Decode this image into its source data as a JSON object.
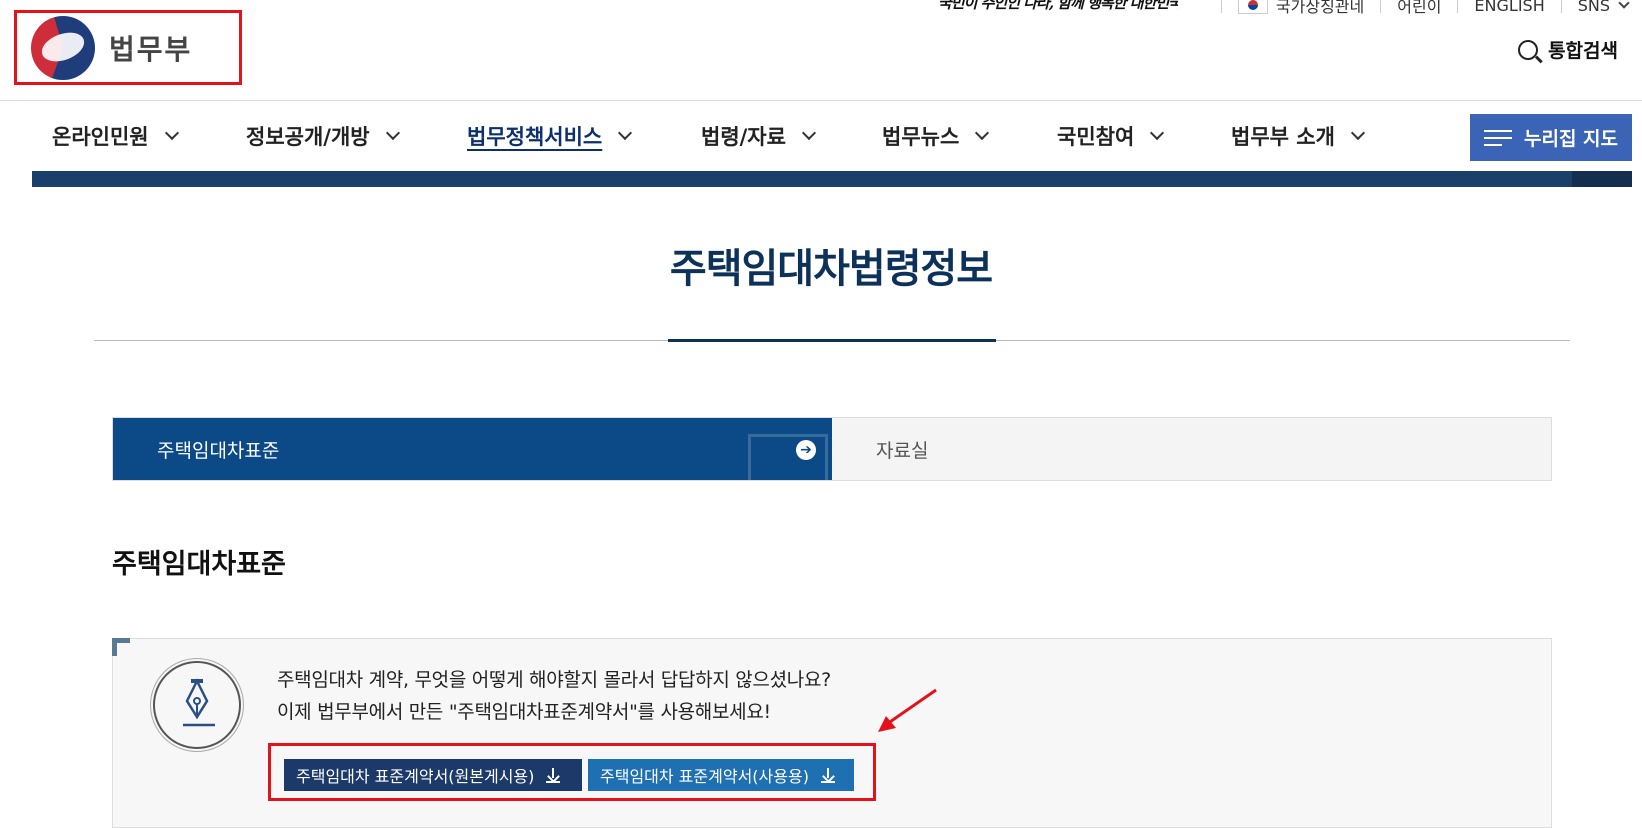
{
  "util": {
    "slogan": "국민이 주인인 나라, 함께 행복한 대한민국",
    "gov_banner": "국가상징관네",
    "kids": "어린이",
    "english": "ENGLISH",
    "sns": "SNS"
  },
  "header": {
    "logo_text": "법무부",
    "search_label": "통합검색"
  },
  "gnb": {
    "items": [
      {
        "label": "온라인민원"
      },
      {
        "label": "정보공개/개방"
      },
      {
        "label": "법무정책서비스"
      },
      {
        "label": "법령/자료"
      },
      {
        "label": "법무뉴스"
      },
      {
        "label": "국민참여"
      },
      {
        "label": "법무부 소개"
      }
    ],
    "map_button": "누리집 지도"
  },
  "page": {
    "title": "주택임대차법령정보"
  },
  "tabs": [
    {
      "label": "주택임대차표준"
    },
    {
      "label": "자료실"
    }
  ],
  "section": {
    "title": "주택임대차표준"
  },
  "info": {
    "line1": "주택임대차 계약, 무엇을 어떻게 해야할지 몰라서 답답하지 않으셨나요?",
    "line2": "이제 법무부에서 만든 \"주택임대차표준계약서\"를 사용해보세요!",
    "btn_original": "주택임대차 표준계약서(원본게시용)",
    "btn_use": "주택임대차 표준계약서(사용용)"
  },
  "colors": {
    "accent_red": "#e3121b",
    "brand_navy": "#0d3259",
    "tab_active": "#0b4a86",
    "map_button": "#3b64b7"
  }
}
